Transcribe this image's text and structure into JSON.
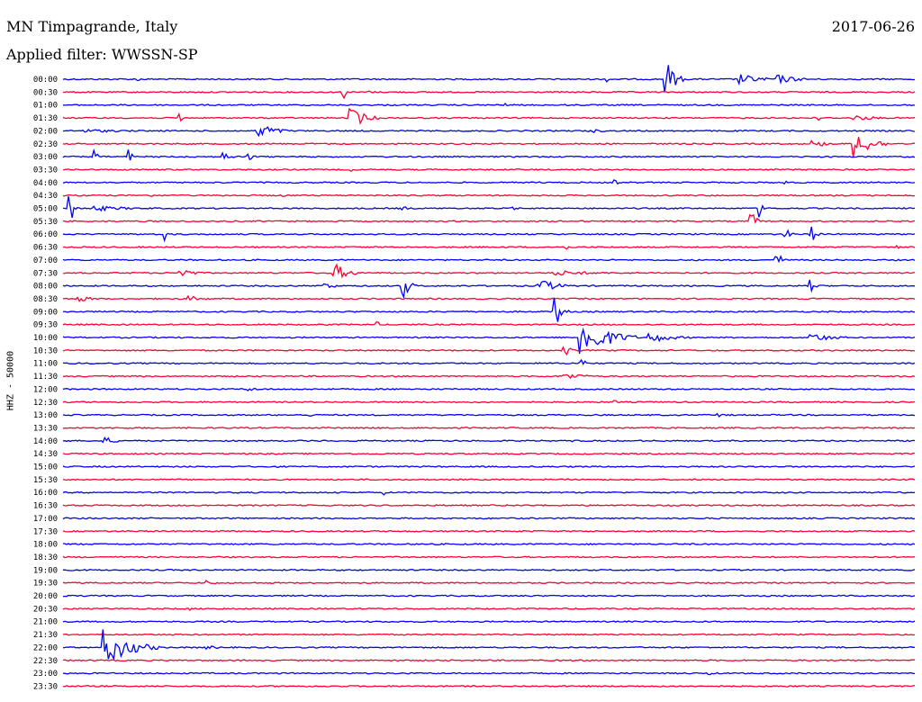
{
  "header": {
    "station": "MN Timpagrande, Italy",
    "date": "2017-06-26",
    "filter": "Applied filter: WWSSN-SP"
  },
  "chart_data": {
    "type": "line",
    "title": "MN Timpagrande, Italy",
    "ylabel": "HHZ - 50000",
    "colors": {
      "even_row": "#0000ff",
      "odd_row": "#ff0033"
    },
    "rows": [
      {
        "time": "00:00",
        "events": [
          {
            "pos": 0.09,
            "amp": 2,
            "dur": 0.003
          },
          {
            "pos": 0.64,
            "amp": 3,
            "dur": 0.003
          },
          {
            "pos": 0.71,
            "amp": 18,
            "dur": 0.02
          },
          {
            "pos": 0.795,
            "amp": 6,
            "dur": 0.05
          },
          {
            "pos": 0.84,
            "amp": 5,
            "dur": 0.05
          }
        ]
      },
      {
        "time": "00:30",
        "events": [
          {
            "pos": 0.33,
            "amp": 8,
            "dur": 0.004
          },
          {
            "pos": 0.36,
            "amp": 2,
            "dur": 0.01
          }
        ]
      },
      {
        "time": "01:00",
        "events": [
          {
            "pos": 0.52,
            "amp": 2,
            "dur": 0.003
          }
        ]
      },
      {
        "time": "01:30",
        "events": [
          {
            "pos": 0.14,
            "amp": 6,
            "dur": 0.004
          },
          {
            "pos": 0.34,
            "amp": 12,
            "dur": 0.03
          },
          {
            "pos": 0.89,
            "amp": 4,
            "dur": 0.003
          },
          {
            "pos": 0.93,
            "amp": 3,
            "dur": 0.06
          }
        ]
      },
      {
        "time": "02:00",
        "events": [
          {
            "pos": 0.02,
            "amp": 2,
            "dur": 0.15
          },
          {
            "pos": 0.23,
            "amp": 10,
            "dur": 0.035
          },
          {
            "pos": 0.62,
            "amp": 2,
            "dur": 0.04
          }
        ]
      },
      {
        "time": "02:30",
        "events": [
          {
            "pos": 0.88,
            "amp": 4,
            "dur": 0.04
          },
          {
            "pos": 0.93,
            "amp": 16,
            "dur": 0.04
          }
        ]
      },
      {
        "time": "03:00",
        "events": [
          {
            "pos": 0.04,
            "amp": 7,
            "dur": 0.004
          },
          {
            "pos": 0.08,
            "amp": 9,
            "dur": 0.004
          },
          {
            "pos": 0.19,
            "amp": 5,
            "dur": 0.02
          },
          {
            "pos": 0.22,
            "amp": 4,
            "dur": 0.01
          }
        ]
      },
      {
        "time": "03:30",
        "events": [
          {
            "pos": 0.34,
            "amp": 2,
            "dur": 0.003
          }
        ]
      },
      {
        "time": "04:00",
        "events": [
          {
            "pos": 0.65,
            "amp": 3,
            "dur": 0.003
          },
          {
            "pos": 0.85,
            "amp": 3,
            "dur": 0.003
          }
        ]
      },
      {
        "time": "04:30",
        "events": [
          {
            "pos": 0.1,
            "amp": 3,
            "dur": 0.01
          },
          {
            "pos": 0.26,
            "amp": 2,
            "dur": 0.003
          }
        ]
      },
      {
        "time": "05:00",
        "events": [
          {
            "pos": 0.01,
            "amp": 14,
            "dur": 0.01
          },
          {
            "pos": 0.04,
            "amp": 3,
            "dur": 0.08
          },
          {
            "pos": 0.4,
            "amp": 6,
            "dur": 0.005
          },
          {
            "pos": 0.53,
            "amp": 4,
            "dur": 0.005
          },
          {
            "pos": 0.82,
            "amp": 10,
            "dur": 0.005
          }
        ]
      },
      {
        "time": "05:30",
        "events": [
          {
            "pos": 0.81,
            "amp": 9,
            "dur": 0.01
          }
        ]
      },
      {
        "time": "06:00",
        "events": [
          {
            "pos": 0.12,
            "amp": 9,
            "dur": 0.006
          },
          {
            "pos": 0.85,
            "amp": 6,
            "dur": 0.01
          },
          {
            "pos": 0.88,
            "amp": 9,
            "dur": 0.01
          }
        ]
      },
      {
        "time": "06:30",
        "events": [
          {
            "pos": 0.59,
            "amp": 8,
            "dur": 0.004
          },
          {
            "pos": 0.98,
            "amp": 2,
            "dur": 0.01
          }
        ]
      },
      {
        "time": "07:00",
        "events": [
          {
            "pos": 0.84,
            "amp": 8,
            "dur": 0.01
          }
        ]
      },
      {
        "time": "07:30",
        "events": [
          {
            "pos": 0.14,
            "amp": 5,
            "dur": 0.03
          },
          {
            "pos": 0.32,
            "amp": 10,
            "dur": 0.03
          },
          {
            "pos": 0.58,
            "amp": 3,
            "dur": 0.1
          }
        ]
      },
      {
        "time": "08:00",
        "events": [
          {
            "pos": 0.31,
            "amp": 4,
            "dur": 0.02
          },
          {
            "pos": 0.4,
            "amp": 13,
            "dur": 0.015
          },
          {
            "pos": 0.56,
            "amp": 8,
            "dur": 0.04
          },
          {
            "pos": 0.88,
            "amp": 7,
            "dur": 0.01
          }
        ]
      },
      {
        "time": "08:30",
        "events": [
          {
            "pos": 0.02,
            "amp": 3,
            "dur": 0.04
          },
          {
            "pos": 0.15,
            "amp": 3,
            "dur": 0.04
          }
        ]
      },
      {
        "time": "09:00",
        "events": [
          {
            "pos": 0.58,
            "amp": 18,
            "dur": 0.012
          }
        ]
      },
      {
        "time": "09:30",
        "events": [
          {
            "pos": 0.37,
            "amp": 3,
            "dur": 0.004
          }
        ]
      },
      {
        "time": "10:00",
        "events": [
          {
            "pos": 0.61,
            "amp": 22,
            "dur": 0.06
          },
          {
            "pos": 0.69,
            "amp": 6,
            "dur": 0.05
          },
          {
            "pos": 0.88,
            "amp": 5,
            "dur": 0.05
          }
        ]
      },
      {
        "time": "10:30",
        "events": [
          {
            "pos": 0.59,
            "amp": 8,
            "dur": 0.01
          }
        ]
      },
      {
        "time": "11:00",
        "events": [
          {
            "pos": 0.61,
            "amp": 12,
            "dur": 0.004
          }
        ]
      },
      {
        "time": "11:30",
        "events": [
          {
            "pos": 0.59,
            "amp": 4,
            "dur": 0.05
          }
        ]
      },
      {
        "time": "12:00",
        "events": [
          {
            "pos": 0.22,
            "amp": 2,
            "dur": 0.03
          }
        ]
      },
      {
        "time": "12:30",
        "events": [
          {
            "pos": 0.65,
            "amp": 2,
            "dur": 0.003
          }
        ]
      },
      {
        "time": "13:00",
        "events": [
          {
            "pos": 0.29,
            "amp": 2,
            "dur": 0.01
          },
          {
            "pos": 0.77,
            "amp": 2,
            "dur": 0.02
          }
        ]
      },
      {
        "time": "13:30",
        "events": []
      },
      {
        "time": "14:00",
        "events": [
          {
            "pos": 0.05,
            "amp": 4,
            "dur": 0.03
          },
          {
            "pos": 0.6,
            "amp": 2,
            "dur": 0.003
          }
        ]
      },
      {
        "time": "14:30",
        "events": []
      },
      {
        "time": "15:00",
        "events": []
      },
      {
        "time": "15:30",
        "events": []
      },
      {
        "time": "16:00",
        "events": [
          {
            "pos": 0.38,
            "amp": 3,
            "dur": 0.004
          }
        ]
      },
      {
        "time": "16:30",
        "events": []
      },
      {
        "time": "17:00",
        "events": []
      },
      {
        "time": "17:30",
        "events": []
      },
      {
        "time": "18:00",
        "events": []
      },
      {
        "time": "18:30",
        "events": []
      },
      {
        "time": "19:00",
        "events": []
      },
      {
        "time": "19:30",
        "events": [
          {
            "pos": 0.17,
            "amp": 3,
            "dur": 0.02
          }
        ]
      },
      {
        "time": "20:00",
        "events": []
      },
      {
        "time": "20:30",
        "events": [
          {
            "pos": 0.15,
            "amp": 2,
            "dur": 0.003
          }
        ]
      },
      {
        "time": "21:00",
        "events": []
      },
      {
        "time": "21:30",
        "events": []
      },
      {
        "time": "22:00",
        "events": [
          {
            "pos": 0.05,
            "amp": 20,
            "dur": 0.06
          },
          {
            "pos": 0.17,
            "amp": 2,
            "dur": 0.04
          }
        ]
      },
      {
        "time": "22:30",
        "events": []
      },
      {
        "time": "23:00",
        "events": [
          {
            "pos": 0.76,
            "amp": 2,
            "dur": 0.003
          }
        ]
      },
      {
        "time": "23:30",
        "events": []
      }
    ]
  }
}
